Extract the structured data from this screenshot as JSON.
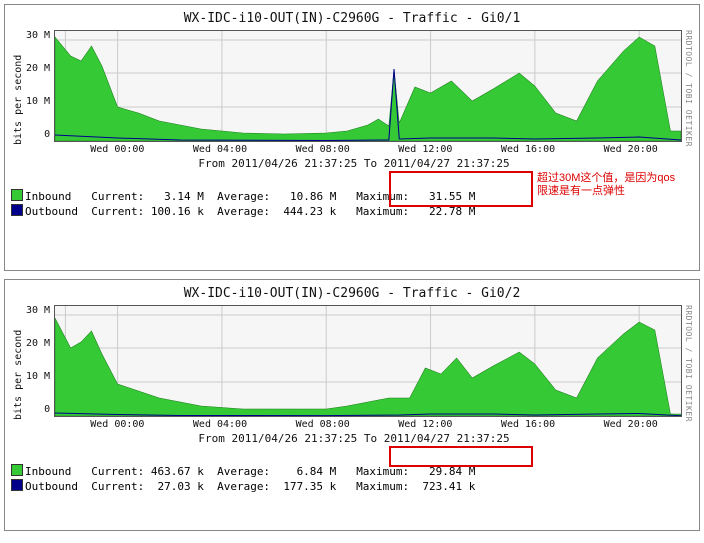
{
  "credit": "RRDTOOL / TOBI OETIKER",
  "ylabel": "bits per second",
  "x_ticks": [
    "Wed 00:00",
    "Wed 04:00",
    "Wed 08:00",
    "Wed 12:00",
    "Wed 16:00",
    "Wed 20:00"
  ],
  "y_ticks": [
    "30 M",
    "20 M",
    "10 M",
    "0"
  ],
  "date_range": "From 2011/04/26 21:37:25 To 2011/04/27 21:37:25",
  "annotation": "超过30M这个值，是因为qos\n限速是有一点弹性",
  "panels": [
    {
      "title": "WX-IDC-i10-OUT(IN)-C2960G - Traffic - Gi0/1",
      "inbound": {
        "label": "Inbound",
        "current": "3.14 M",
        "average": "10.86 M",
        "maximum": "31.55 M"
      },
      "outbound": {
        "label": "Outbound",
        "current": "100.16 k",
        "average": "444.23 k",
        "maximum": "22.78 M"
      },
      "highlight": "maximum"
    },
    {
      "title": "WX-IDC-i10-OUT(IN)-C2960G - Traffic - Gi0/2",
      "inbound": {
        "label": "Inbound",
        "current": "463.67 k",
        "average": "6.84 M",
        "maximum": "29.84 M"
      },
      "outbound": {
        "label": "Outbound",
        "current": "27.03 k",
        "average": "177.35 k",
        "maximum": "723.41 k"
      },
      "highlight": "maximum"
    }
  ],
  "leg_labels": {
    "current": "Current:",
    "average": "Average:",
    "maximum": "Maximum:"
  },
  "chart_data": [
    {
      "type": "area",
      "title": "WX-IDC-i10-OUT(IN)-C2960G - Traffic - Gi0/1",
      "xlabel": "",
      "ylabel": "bits per second",
      "ylim": [
        0,
        32000000
      ],
      "x": [
        "21:37",
        "22:00",
        "22:30",
        "23:00",
        "23:30",
        "00:00",
        "00:30",
        "01:00",
        "02:00",
        "03:00",
        "04:00",
        "05:00",
        "06:00",
        "07:00",
        "08:00",
        "08:30",
        "09:00",
        "09:20",
        "09:30",
        "10:00",
        "11:00",
        "12:00",
        "13:00",
        "14:00",
        "15:00",
        "16:00",
        "17:00",
        "18:00",
        "19:00",
        "20:00",
        "20:30",
        "21:00",
        "21:37"
      ],
      "series": [
        {
          "name": "Inbound",
          "values": [
            31,
            25,
            23,
            28,
            22,
            10,
            8,
            6,
            4,
            3,
            2,
            2,
            2,
            3,
            3,
            5,
            4,
            22,
            6,
            16,
            14,
            18,
            12,
            15,
            20,
            16,
            8,
            6,
            18,
            27,
            31,
            28,
            3
          ],
          "unit": "M"
        },
        {
          "name": "Outbound",
          "values": [
            2,
            2,
            2,
            2,
            1,
            0.5,
            0.4,
            0.3,
            0.2,
            0.2,
            0.1,
            0.1,
            0.1,
            0.1,
            0.1,
            0.2,
            0.2,
            22,
            0.3,
            0.5,
            0.6,
            0.8,
            0.7,
            0.7,
            0.8,
            0.6,
            0.4,
            0.3,
            0.7,
            1,
            1,
            0.8,
            0.1
          ],
          "unit": "M"
        }
      ]
    },
    {
      "type": "area",
      "title": "WX-IDC-i10-OUT(IN)-C2960G - Traffic - Gi0/2",
      "xlabel": "",
      "ylabel": "bits per second",
      "ylim": [
        0,
        32000000
      ],
      "x": [
        "21:37",
        "22:00",
        "22:30",
        "23:00",
        "23:30",
        "00:00",
        "00:30",
        "01:00",
        "02:00",
        "03:00",
        "04:00",
        "05:00",
        "06:00",
        "07:00",
        "08:00",
        "08:30",
        "09:00",
        "09:30",
        "10:00",
        "11:00",
        "12:00",
        "13:00",
        "14:00",
        "15:00",
        "16:00",
        "17:00",
        "18:00",
        "19:00",
        "20:00",
        "20:30",
        "21:00",
        "21:37"
      ],
      "series": [
        {
          "name": "Inbound",
          "values": [
            29,
            20,
            22,
            25,
            18,
            9,
            7,
            5,
            3,
            2,
            2,
            2,
            2,
            2,
            3,
            4,
            5,
            5,
            14,
            12,
            17,
            11,
            14,
            19,
            15,
            8,
            6,
            17,
            25,
            28,
            26,
            0.5
          ],
          "unit": "M"
        },
        {
          "name": "Outbound",
          "values": [
            0.7,
            0.6,
            0.6,
            0.6,
            0.5,
            0.3,
            0.2,
            0.2,
            0.1,
            0.1,
            0.05,
            0.05,
            0.05,
            0.05,
            0.05,
            0.1,
            0.1,
            0.1,
            0.3,
            0.3,
            0.4,
            0.3,
            0.3,
            0.4,
            0.3,
            0.2,
            0.1,
            0.3,
            0.5,
            0.6,
            0.5,
            0.03
          ],
          "unit": "M"
        }
      ]
    }
  ]
}
